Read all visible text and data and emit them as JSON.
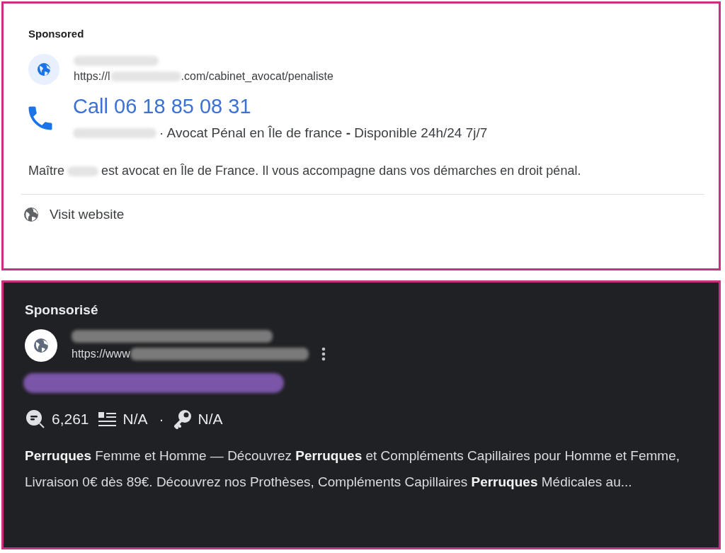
{
  "light_ad": {
    "label": "Sponsored",
    "url_start": "https://l",
    "url_end": ".com/cabinet_avocat/penaliste",
    "call": "Call 06 18 85 08 31",
    "business_rest": "· Avocat Pénal en Île de france **-** Disponible 24h/24 7j/7",
    "description_start": "Maître",
    "description_end": "est avocat en Île de France. Il vous accompagne dans vos démarches en droit pénal.",
    "visit": "Visit website"
  },
  "dark_ad": {
    "label": "Sponsorisé",
    "url_start": "https://www",
    "stats": [
      {
        "kind": "searches",
        "value": "6,261"
      },
      {
        "kind": "listing",
        "value": "N/A"
      },
      {
        "kind": "separator",
        "value": "·"
      },
      {
        "kind": "key",
        "value": "N/A"
      }
    ],
    "description": "**Perruques** Femme et Homme — Découvrez **Perruques** et Compléments Capillaires pour Homme et Femme, Livraison 0€ dès 89€. Découvrez nos Prothèses, Compléments Capillaires **Perruques** Médicales au..."
  }
}
